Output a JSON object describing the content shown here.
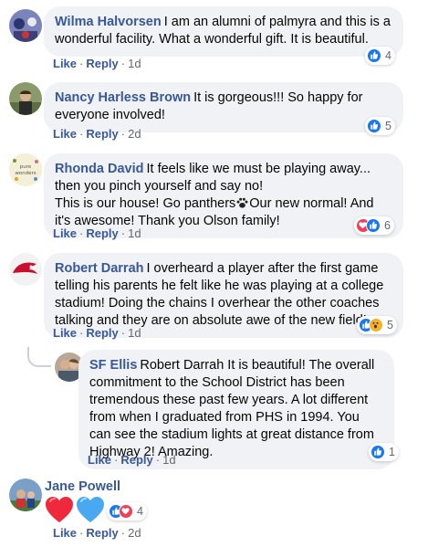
{
  "comments": [
    {
      "author": "Wilma Halvorsen",
      "text": "I am an alumni of palmyra and this is a wonderful facility. What a wonderful gift. It is beautiful.",
      "like": "Like",
      "reply": "Reply",
      "time": "1d",
      "reaction_count": "4"
    },
    {
      "author": "Nancy Harless Brown",
      "text": "It is gorgeous!!! So happy for everyone involved!",
      "like": "Like",
      "reply": "Reply",
      "time": "2d",
      "reaction_count": "5"
    },
    {
      "author": "Rhonda David",
      "text_line1": "It feels like we must be playing away... then you pinch yourself and say no!",
      "text_line2a": "This is our house! Go panthers",
      "text_line2b": "Our new normal! And it's awesome! Thank you Olson family!",
      "like": "Like",
      "reply": "Reply",
      "time": "1d",
      "reaction_count": "6",
      "avatar_text": "pure wonders"
    },
    {
      "author": "Robert Darrah",
      "text": "I overheard a player after the first game telling his parents he felt like he was playing at a college stadium! Doing the chains I overhear the other coaches talking and they are on absolute awe of the new field!",
      "like": "Like",
      "reply": "Reply",
      "time": "1d",
      "reaction_count": "5"
    },
    {
      "author": "SF Ellis",
      "text": "Robert Darrah It is beautiful! The overall commitment to the School District has been tremendous these past few years. A lot different from when I graduated from PHS in 1994. You can see the stadium lights at great distance from Highway 2! Amazing.",
      "like": "Like",
      "reply": "Reply",
      "time": "1d",
      "reaction_count": "1"
    },
    {
      "author": "Jane Powell",
      "like": "Like",
      "reply": "Reply",
      "time": "2d",
      "reaction_count": "4"
    }
  ],
  "colors": {
    "link": "#385898",
    "bubble": "#f0f2f5",
    "like": "#1877f2",
    "love": "#f33e58",
    "wow": "#f7b125",
    "heart_blue": "#4aa8f0"
  },
  "icons": [
    "like-icon",
    "love-icon",
    "wow-icon",
    "paw-icon",
    "red-heart-icon",
    "blue-heart-icon"
  ]
}
